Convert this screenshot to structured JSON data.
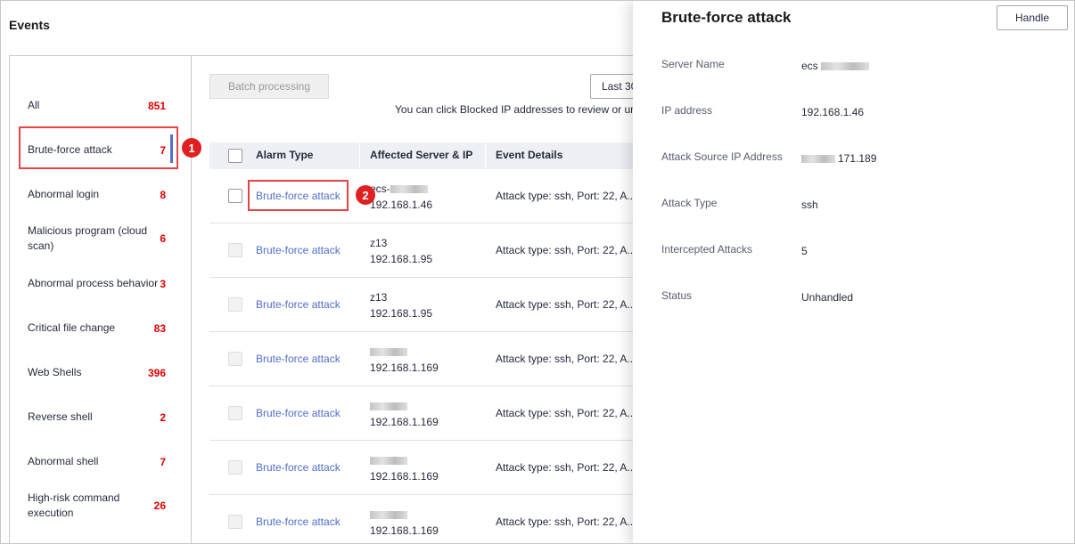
{
  "page": {
    "title": "Events"
  },
  "categories": [
    {
      "label": "All",
      "count": "851"
    },
    {
      "label": "Brute-force attack",
      "count": "7"
    },
    {
      "label": "Abnormal login",
      "count": "8"
    },
    {
      "label": "Malicious program (cloud scan)",
      "count": "6"
    },
    {
      "label": "Abnormal process behavior",
      "count": "3"
    },
    {
      "label": "Critical file change",
      "count": "83"
    },
    {
      "label": "Web Shells",
      "count": "396"
    },
    {
      "label": "Reverse shell",
      "count": "2"
    },
    {
      "label": "Abnormal shell",
      "count": "7"
    },
    {
      "label": "High-risk command execution",
      "count": "26"
    }
  ],
  "toolbar": {
    "batch_label": "Batch processing",
    "time_range": "Last 30",
    "hint": "You can click Blocked IP addresses to review or un"
  },
  "table": {
    "columns": [
      "Alarm Type",
      "Affected Server & IP",
      "Event Details"
    ],
    "rows": [
      {
        "alarm": "Brute-force attack",
        "server": "ecs-",
        "ip": "192.168.1.46",
        "details": "Attack type: ssh, Port: 22, A..."
      },
      {
        "alarm": "Brute-force attack",
        "server": "z13",
        "ip": "192.168.1.95",
        "details": "Attack type: ssh, Port: 22, A..."
      },
      {
        "alarm": "Brute-force attack",
        "server": "z13",
        "ip": "192.168.1.95",
        "details": "Attack type: ssh, Port: 22, A..."
      },
      {
        "alarm": "Brute-force attack",
        "server": "",
        "ip": "192.168.1.169",
        "details": "Attack type: ssh, Port: 22, A..."
      },
      {
        "alarm": "Brute-force attack",
        "server": "",
        "ip": "192.168.1.169",
        "details": "Attack type: ssh, Port: 22, A..."
      },
      {
        "alarm": "Brute-force attack",
        "server": "",
        "ip": "192.168.1.169",
        "details": "Attack type: ssh, Port: 22, A..."
      },
      {
        "alarm": "Brute-force attack",
        "server": "",
        "ip": "192.168.1.169",
        "details": "Attack type: ssh, Port: 22, A..."
      }
    ]
  },
  "annotations": {
    "step1": "1",
    "step2": "2"
  },
  "drawer": {
    "title": "Brute-force attack",
    "handle_label": "Handle",
    "fields": [
      {
        "label": "Server Name",
        "value": "ecs"
      },
      {
        "label": "IP address",
        "value": "192.168.1.46"
      },
      {
        "label": "Attack Source IP Address",
        "value": "171.189"
      },
      {
        "label": "Attack Type",
        "value": "ssh"
      },
      {
        "label": "Intercepted Attacks",
        "value": "5"
      },
      {
        "label": "Status",
        "value": "Unhandled"
      }
    ]
  },
  "colors": {
    "link": "#526ecc",
    "count": "#e00000",
    "highlight": "#e64545",
    "badge": "#e02020"
  }
}
